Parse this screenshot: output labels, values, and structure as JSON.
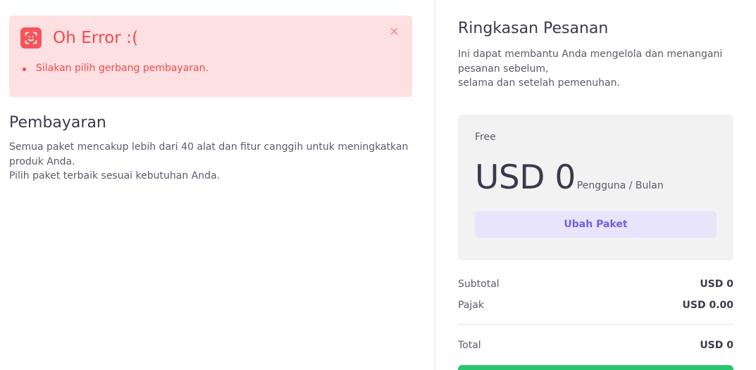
{
  "alert": {
    "title": "Oh Error :(",
    "close": "×",
    "messages": [
      "Silakan pilih gerbang pembayaran."
    ],
    "icon": "face-scan-icon",
    "color": "#f4555a"
  },
  "payment": {
    "title": "Pembayaran",
    "description_line1": "Semua paket mencakup lebih dari 40 alat dan fitur canggih untuk meningkatkan produk Anda.",
    "description_line2": "Pilih paket terbaik sesuai kebutuhan Anda."
  },
  "summary": {
    "title": "Ringkasan Pesanan",
    "description_line1": "Ini dapat membantu Anda mengelola dan menangani pesanan sebelum,",
    "description_line2": "selama dan setelah pemenuhan."
  },
  "plan": {
    "name": "Free",
    "price": "USD 0",
    "unit": "Pengguna / Bulan",
    "change_button": "Ubah Paket"
  },
  "totals": {
    "subtotal_label": "Subtotal",
    "subtotal_value": "USD 0",
    "tax_label": "Pajak",
    "tax_value": "USD 0.00",
    "total_label": "Total",
    "total_value": "USD 0"
  },
  "colors": {
    "accent": "#7561d8",
    "success": "#28c76f",
    "error": "#ef4a50"
  }
}
